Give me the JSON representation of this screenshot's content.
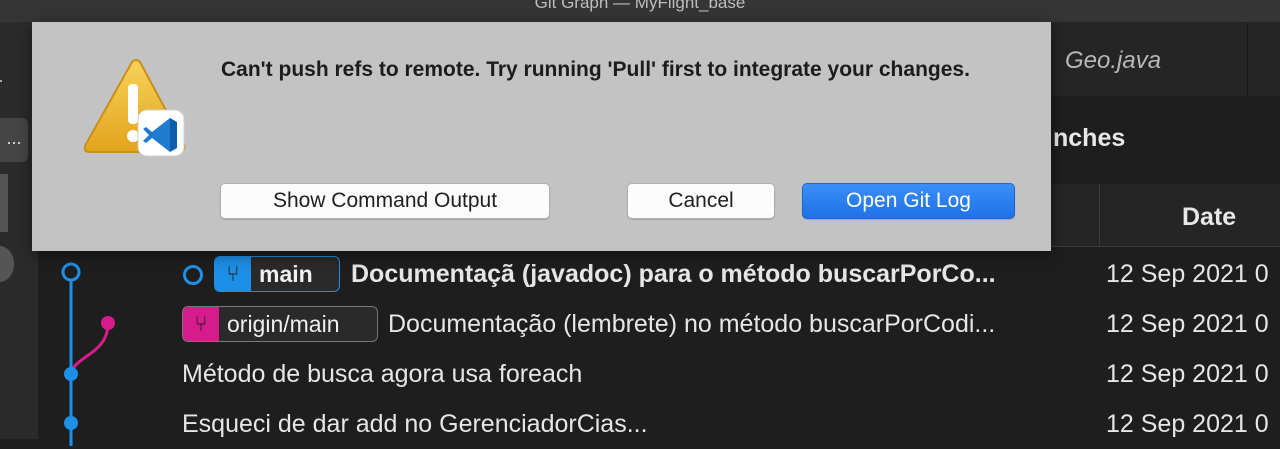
{
  "window": {
    "title": "Git Graph — MyFlight_base"
  },
  "activity_bar": {
    "more_label": "..."
  },
  "editor_tab": {
    "label": "Geo.java"
  },
  "panel": {
    "header_title": "nches",
    "date_column_header": "Date"
  },
  "commits": [
    {
      "ref": {
        "name": "main",
        "icon": "branch-icon",
        "color": "#1e8fe6"
      },
      "subject": "Documentaçã (javadoc) para o método buscarPorCo...",
      "date": "12 Sep 2021 0",
      "bold": true,
      "is_head": true
    },
    {
      "ref": {
        "name": "origin/main",
        "icon": "branch-icon",
        "color": "#d81b8c"
      },
      "subject": "Documentação (lembrete) no método buscarPorCodi...",
      "date": "12 Sep 2021 0",
      "bold": false
    },
    {
      "subject": "Método de busca agora usa foreach",
      "date": "12 Sep 2021 0",
      "bold": false
    },
    {
      "subject": "Esqueci de dar add no GerenciadorCias...",
      "date": "12 Sep 2021 0",
      "bold": false
    }
  ],
  "dialog": {
    "message": "Can't push refs to remote. Try running 'Pull' first to integrate your changes.",
    "icon": "warning-icon",
    "app_badge_icon": "vscode-icon",
    "buttons": {
      "show_output": "Show Command Output",
      "cancel": "Cancel",
      "open_log": "Open Git Log"
    }
  },
  "colors": {
    "graph_blue": "#1e8fe6",
    "graph_magenta": "#d81b8c",
    "primary_button": "#2b7ef0"
  }
}
